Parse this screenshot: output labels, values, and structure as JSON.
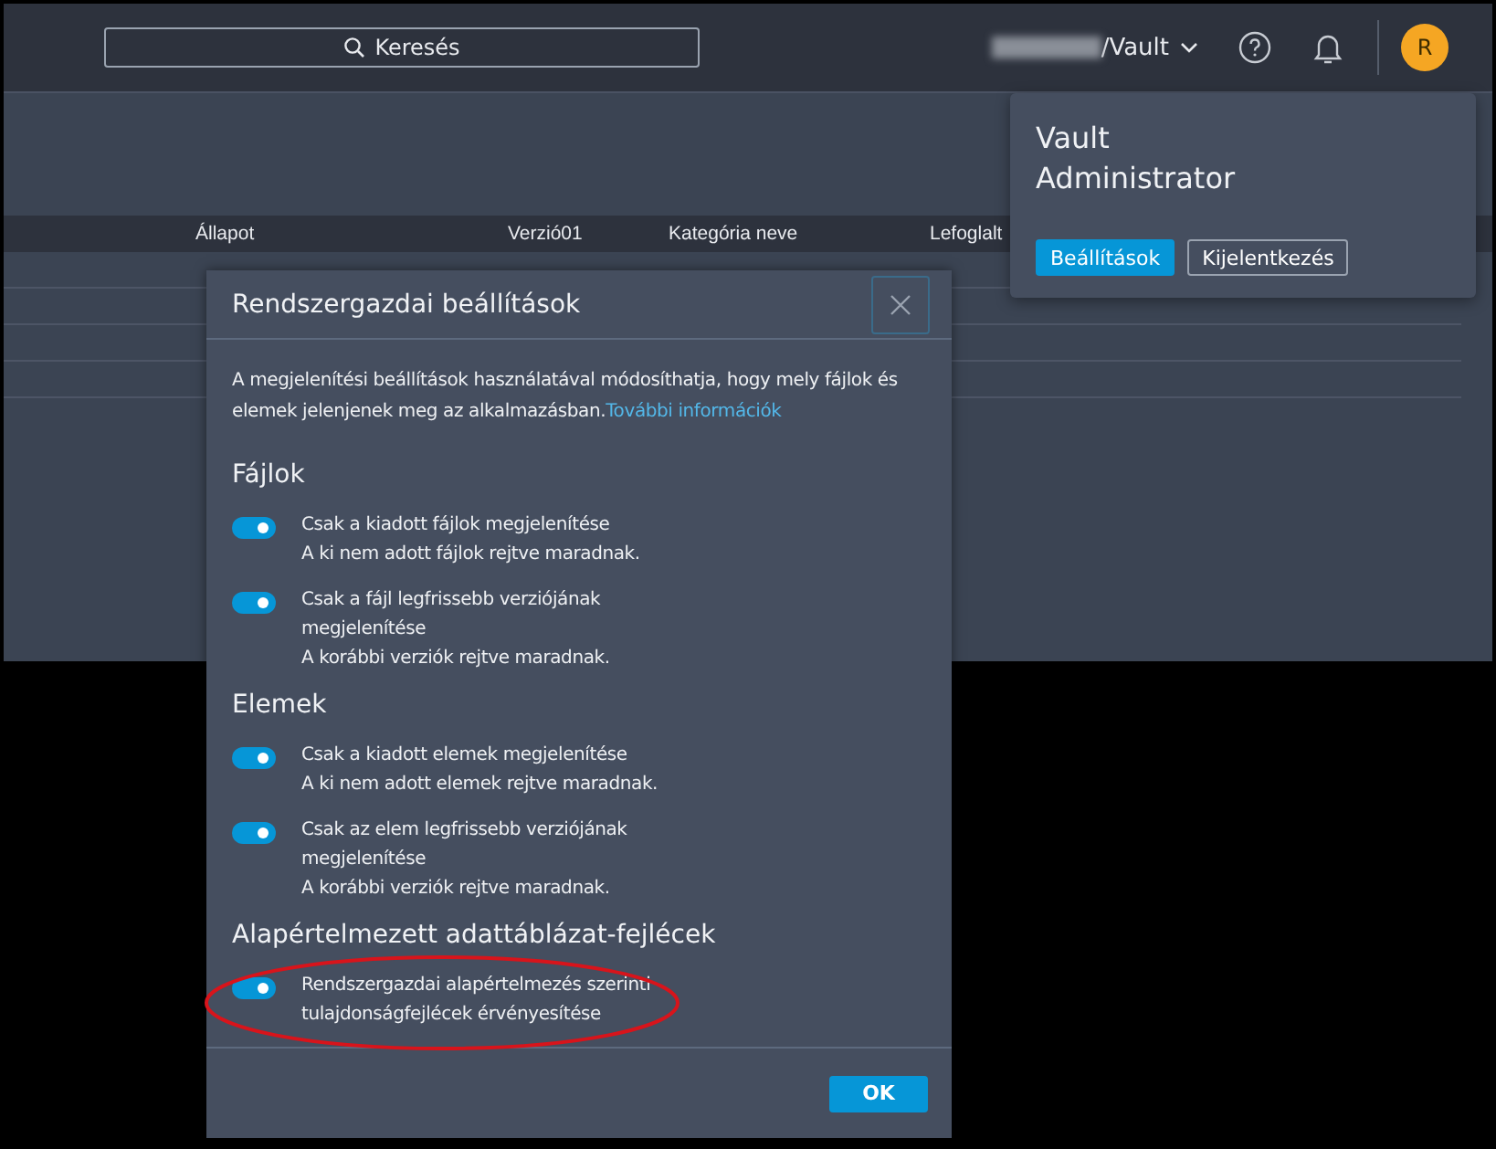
{
  "header": {
    "search": {
      "placeholder": "Keresés"
    },
    "vault": "/Vault",
    "avatar": "R"
  },
  "table": {
    "columns": [
      "Állapot",
      "Verzió01",
      "Kategória neve",
      "Lefoglalt"
    ]
  },
  "user_menu": {
    "name": "Vault Administrator",
    "buttons": [
      {
        "label": "Beállítások",
        "primary": true
      },
      {
        "label": "Kijelentkezés",
        "primary": false
      }
    ]
  },
  "dialog": {
    "title": "Rendszergazdai beállítások",
    "intro": "A megjelenítési beállítások használatával módosíthatja, hogy mely fájlok és elemek jelenjenek meg az alkalmazásban.",
    "link": "További információk",
    "sections": [
      {
        "title": "Fájlok",
        "options": [
          {
            "label": "Csak a kiadott fájlok megjelenítése",
            "description": "A ki nem adott fájlok rejtve maradnak.",
            "on": true
          },
          {
            "label": "Csak a fájl legfrissebb verziójának megjelenítése",
            "description": "A korábbi verziók rejtve maradnak.",
            "on": true
          }
        ]
      },
      {
        "title": "Elemek",
        "options": [
          {
            "label": "Csak a kiadott elemek megjelenítése",
            "description": "A ki nem adott elemek rejtve maradnak.",
            "on": true
          },
          {
            "label": "Csak az elem legfrissebb verziójának megjelenítése",
            "description": "A korábbi verziók rejtve maradnak.",
            "on": true
          }
        ]
      },
      {
        "title": "Alapértelmezett adattáblázat-fejlécek",
        "options": [
          {
            "label": "Rendszergazdai alapértelmezés szerinti tulajdonságfejlécek érvényesítése",
            "on": true,
            "highlighted": true
          }
        ]
      }
    ],
    "ok": "OK"
  }
}
